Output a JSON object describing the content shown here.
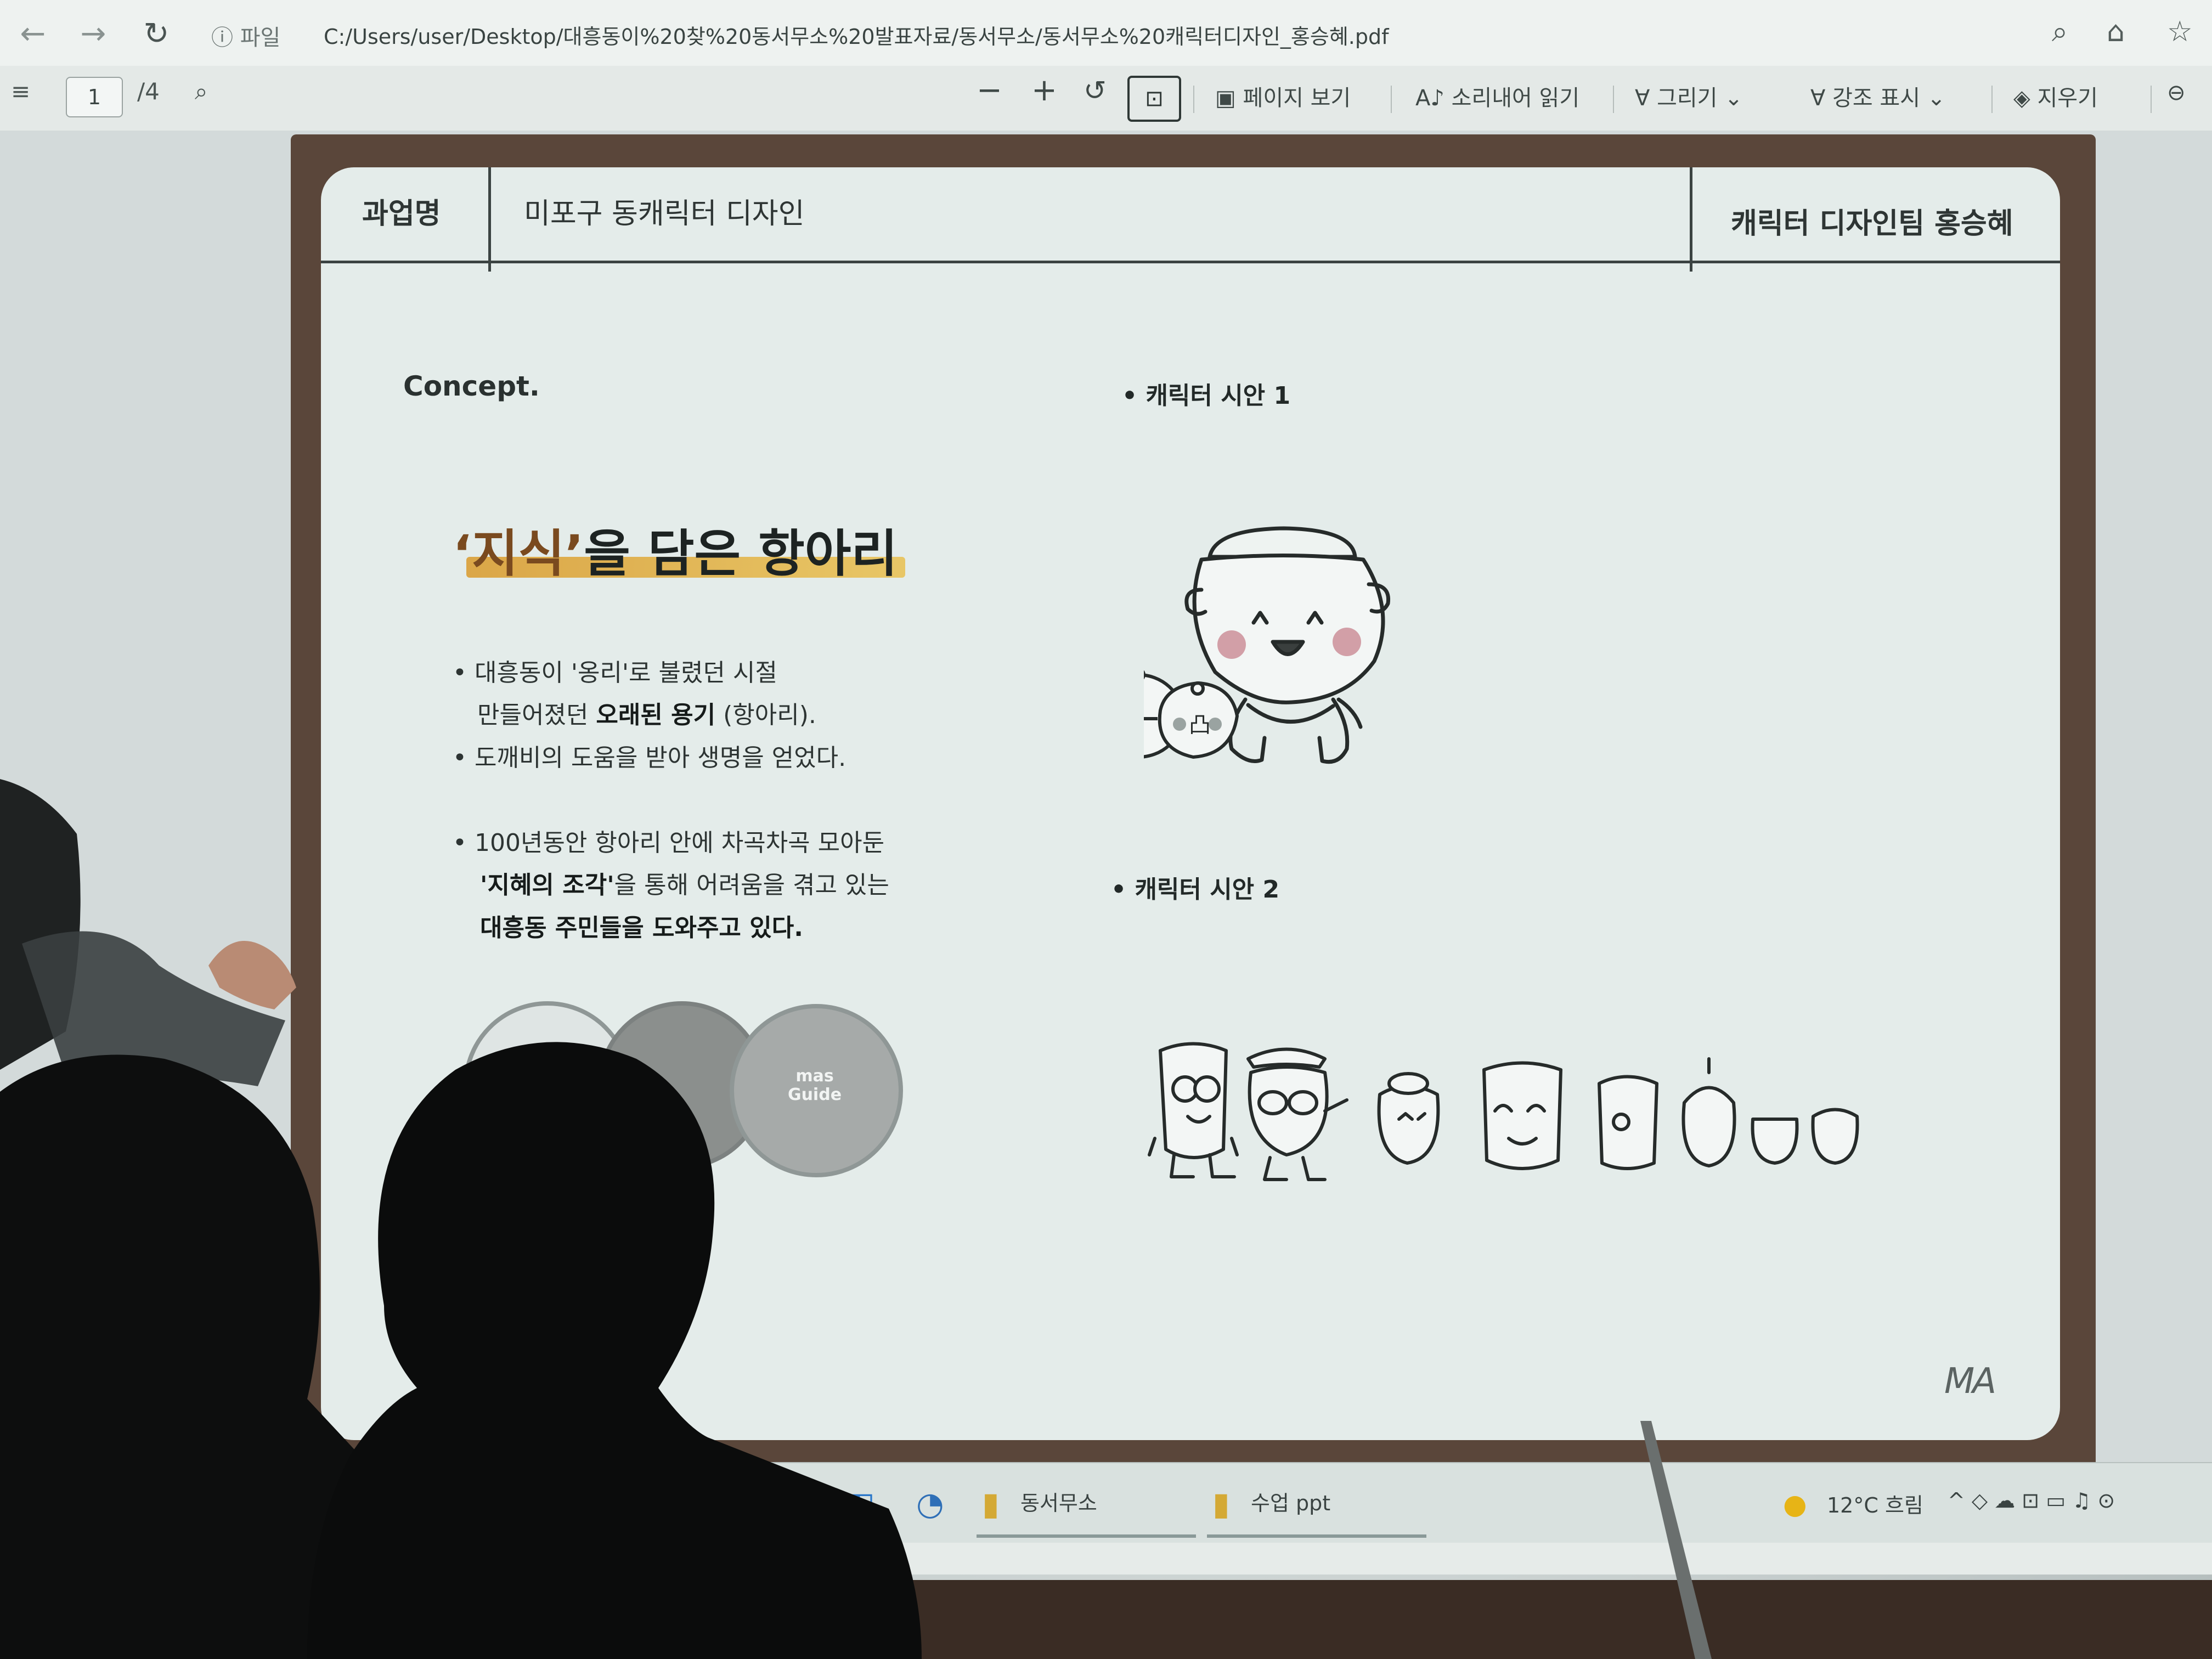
{
  "browser": {
    "back_icon": "←",
    "forward_icon": "→",
    "reload_icon": "↻",
    "info_icon": "ⓘ",
    "file_label": "파일",
    "url": "C:/Users/user/Desktop/대흥동이%20찾%20동서무소%20발표자료/동서무소/동서무소%20캐릭터디자인_홍승혜.pdf",
    "zoom_icon": "⌕",
    "favorite_icon": "☆"
  },
  "toolbar": {
    "page_number": "1",
    "page_total": "/4",
    "search_icon": "⌕",
    "zoom_out": "−",
    "zoom_in": "+",
    "rotate_icon": "↺",
    "fit_icon": "⊡",
    "page_view": "페이지 보기",
    "read_aloud": "소리내어 읽기",
    "draw": "그리기",
    "highlight": "강조 표시",
    "erase": "지우기"
  },
  "slide": {
    "header": {
      "subject_label": "과업명",
      "subject_value": "미포구 동캐릭터 디자인",
      "team": "캐릭터 디자인팀 홍승혜"
    },
    "concept_label": "Concept.",
    "headline_highlight": "‘지식’",
    "headline_rest": "을 담은 항아리",
    "bullets": [
      {
        "prefix": "• ",
        "text": "대흥동이 '옹리'로 불렸던 시절"
      },
      {
        "prefix": "",
        "text_before": "만들어졌던 ",
        "bold": "오래된 용기",
        "text_after": " (항아리)."
      },
      {
        "prefix": "• ",
        "text": "도깨비의 도움을 받아 생명을 얻었다."
      },
      {
        "prefix": "• ",
        "text": "100년동안 항아리 안에 차곡차곡 모아둔"
      },
      {
        "prefix": "",
        "bold": "'지혜의 조각'",
        "text_after": "을 통해 어려움을 겪고 있는"
      },
      {
        "prefix": "",
        "bold": "대흥동 주민들을 도와주고 있다."
      }
    ],
    "circle_label": "mas\nGuide",
    "option1_title": "• 캐릭터 시안 1",
    "option2_title": "• 캐릭터 시안 2",
    "logo": "MA"
  },
  "taskbar": {
    "item1": "동서무소",
    "item2": "수업 ppt",
    "weather": "12°C 흐림",
    "tray_icons": "^  ◇  ☁  ⊡  ▭  ♫  ⊙"
  },
  "colors": {
    "slide_bg": "#e4ecea",
    "frame": "#5a463a",
    "highlight_bar": "#e0ac3a",
    "headline_accent": "#7a4a1f"
  }
}
